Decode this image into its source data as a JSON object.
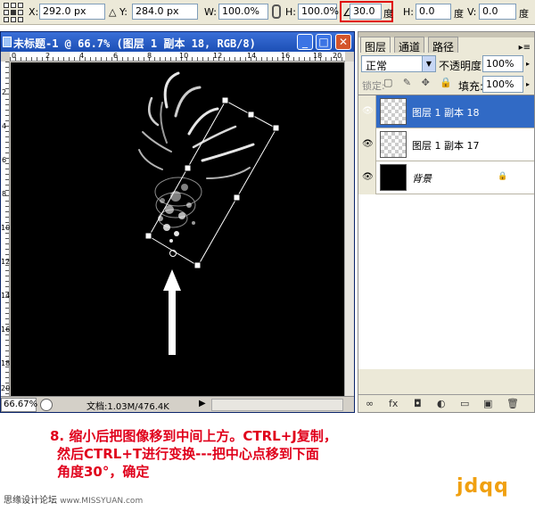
{
  "options_bar": {
    "x_label": "X:",
    "x_value": "292.0 px",
    "y_label": "Y:",
    "y_value": "284.0 px",
    "w_label": "W:",
    "w_value": "100.0%",
    "h_label": "H:",
    "h_value": "100.0%",
    "angle_value": "30.0",
    "angle_unit": "度",
    "hskew_label": "H:",
    "hskew_value": "0.0",
    "hskew_unit": "度",
    "vskew_label": "V:",
    "vskew_value": "0.0",
    "vskew_unit": "度",
    "highlight_color": "#e00000"
  },
  "document": {
    "title": "未标题-1 @ 66.7% (图层 1 副本 18, RGB/8)",
    "minimize": "_",
    "maximize": "□",
    "close": "✕",
    "ruler_top": [
      "0",
      "2",
      "4",
      "6",
      "8",
      "10",
      "12",
      "14",
      "16",
      "18",
      "20"
    ],
    "ruler_left": [
      "2",
      "4",
      "6",
      "8",
      "10",
      "12",
      "14",
      "16",
      "18",
      "20"
    ],
    "zoom": "66.67%",
    "doc_info": "文档:1.03M/476.4K",
    "arrow": "▶"
  },
  "layers_panel": {
    "tabs": [
      "图层",
      "通道",
      "路径"
    ],
    "menu_icon": "▸≡",
    "blend_mode": "正常",
    "opacity_label": "不透明度:",
    "opacity_value": "100%",
    "lock_label": "锁定:",
    "lock_icons": "▢ ✎ ✥ 🔒",
    "fill_label": "填充:",
    "fill_value": "100%",
    "layers": [
      {
        "name": "图层 1 副本 18",
        "selected": true,
        "thumb": "transparent"
      },
      {
        "name": "图层 1 副本 17",
        "selected": false,
        "thumb": "transparent"
      },
      {
        "name": "背景",
        "selected": false,
        "thumb": "black",
        "locked": true
      }
    ],
    "footer_icons": [
      "∞",
      "fx",
      "◘",
      "◐",
      "▭",
      "▣",
      "🗑"
    ],
    "selected_color": "#316ac5"
  },
  "caption": {
    "line1": "8. 缩小后把图像移到中间上方。CTRL+J复制，",
    "line2": "然后CTRL+T进行变换---把中心点移到下面",
    "line3": "角度30°，确定",
    "color": "#e0001b"
  },
  "footer": {
    "site": "思缘设计论坛",
    "url": "www.MISSYUAN.com",
    "brand": "jdqq",
    "brand_color": "#f0a010"
  }
}
